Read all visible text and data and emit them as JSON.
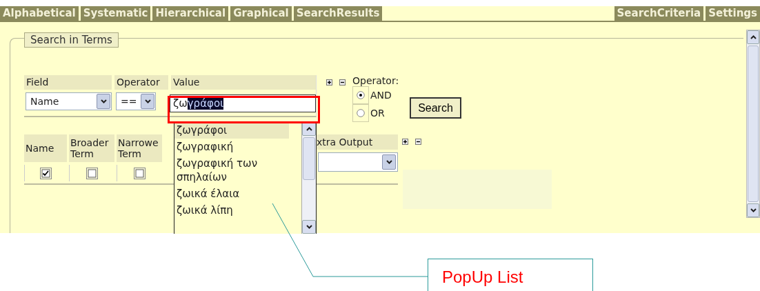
{
  "tabs_left": [
    {
      "label": "Alphabetical"
    },
    {
      "label": "Systematic"
    },
    {
      "label": "Hierarchical"
    },
    {
      "label": "Graphical"
    },
    {
      "label": "SearchResults"
    }
  ],
  "tabs_right": [
    {
      "label": "SearchCriteria"
    },
    {
      "label": "Settings"
    }
  ],
  "legend": "Search in Terms",
  "criteria": {
    "headers": [
      "Field",
      "Operator",
      "Value"
    ],
    "field": "Name",
    "operator": "==",
    "value_typed": "ζω",
    "value_selected": "γράφοι"
  },
  "operator_group": {
    "label": "Operator:",
    "options": [
      {
        "label": "AND",
        "selected": true
      },
      {
        "label": "OR",
        "selected": false
      }
    ]
  },
  "search_button": "Search",
  "output_columns": [
    {
      "label": "Name",
      "checked": true
    },
    {
      "label": "Broader Term",
      "checked": false
    },
    {
      "label": "Narrowe Term",
      "checked": false
    }
  ],
  "extra_output": {
    "label": "xtra Output"
  },
  "popup_items": [
    {
      "label": "ζωγράφοι",
      "selected": true
    },
    {
      "label": "ζωγραφική",
      "selected": false
    },
    {
      "label": "ζωγραφική των σπηλαίων",
      "selected": false
    },
    {
      "label": "ζωικά έλαια",
      "selected": false
    },
    {
      "label": "ζωικά λίπη",
      "selected": false
    }
  ],
  "callout": "PopUp List"
}
